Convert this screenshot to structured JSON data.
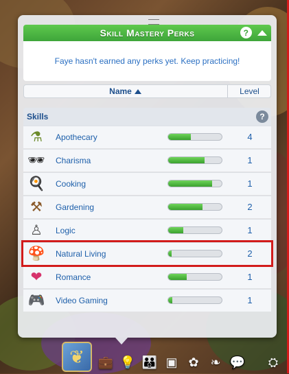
{
  "panel": {
    "title": "Skill Mastery Perks",
    "help_label": "?",
    "message": "Faye hasn't earned any perks yet. Keep practicing!"
  },
  "sort": {
    "name_label": "Name",
    "level_label": "Level"
  },
  "skills": {
    "header": "Skills",
    "help_label": "?",
    "items": [
      {
        "name": "Apothecary",
        "level": "4",
        "progress": 0.42,
        "icon": "mortar-pestle-icon"
      },
      {
        "name": "Charisma",
        "level": "1",
        "progress": 0.68,
        "icon": "sunglasses-icon"
      },
      {
        "name": "Cooking",
        "level": "1",
        "progress": 0.82,
        "icon": "frying-pan-icon"
      },
      {
        "name": "Gardening",
        "level": "2",
        "progress": 0.64,
        "icon": "garden-tools-icon"
      },
      {
        "name": "Logic",
        "level": "1",
        "progress": 0.28,
        "icon": "chess-pawn-icon"
      },
      {
        "name": "Natural Living",
        "level": "2",
        "progress": 0.06,
        "icon": "natural-living-icon"
      },
      {
        "name": "Romance",
        "level": "1",
        "progress": 0.34,
        "icon": "heart-rose-icon"
      },
      {
        "name": "Video Gaming",
        "level": "1",
        "progress": 0.08,
        "icon": "gamepad-icon"
      }
    ]
  },
  "selected_skill": "Natural Living",
  "colors": {
    "accent": "#3ea53a",
    "text_blue": "#1d5faa",
    "highlight": "#d21b1b"
  },
  "bottom_tabs": [
    "aspiration-butterfly-icon",
    "career-briefcase-icon",
    "skills-lightbulb-icon",
    "relationships-icon",
    "inventory-box-icon",
    "motives-icon",
    "traits-icon",
    "chat-bubble-icon",
    "sim-info-icon"
  ]
}
